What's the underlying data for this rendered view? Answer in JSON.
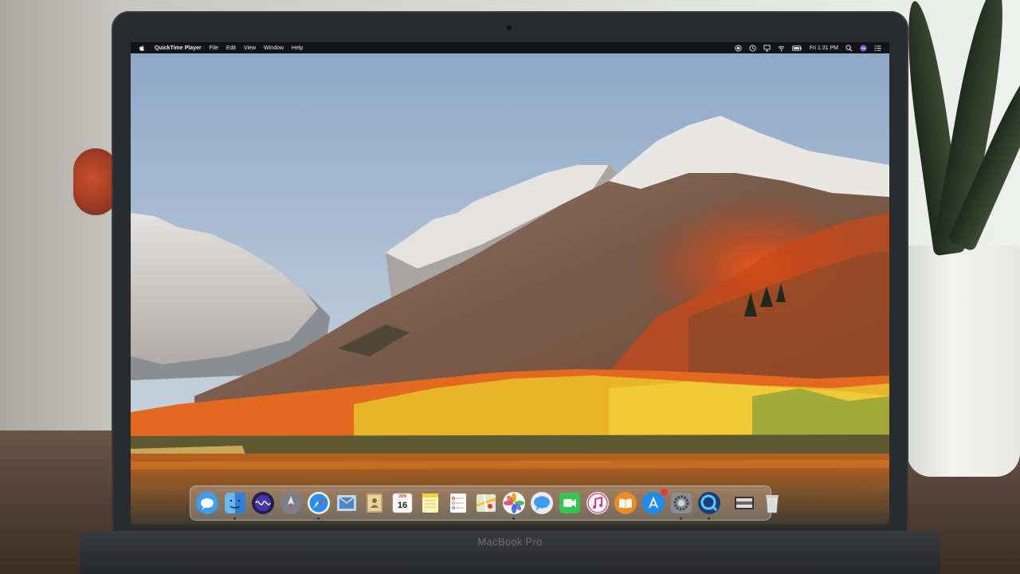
{
  "menubar": {
    "app_name": "QuickTime Player",
    "menus": [
      "File",
      "Edit",
      "View",
      "Window",
      "Help"
    ],
    "clock": "Fri 1:31 PM"
  },
  "device": {
    "brand_label": "MacBook Pro"
  },
  "dock": {
    "calendar_month": "JUN",
    "calendar_day": "16",
    "messages_badge": "",
    "apps": [
      "Messages",
      "Finder",
      "Siri",
      "Launchpad",
      "Safari",
      "Mail",
      "Contacts",
      "Calendar",
      "Notes",
      "Reminders",
      "Maps",
      "Photos",
      "Messages",
      "FaceTime",
      "iTunes",
      "iBooks",
      "App Store",
      "System Preferences",
      "QuickTime Player",
      "Downloads",
      "Trash"
    ]
  },
  "colors": {
    "menubar_bg": "#121316",
    "foliage_orange": "#e2691f",
    "foliage_yellow": "#e8b52a"
  }
}
